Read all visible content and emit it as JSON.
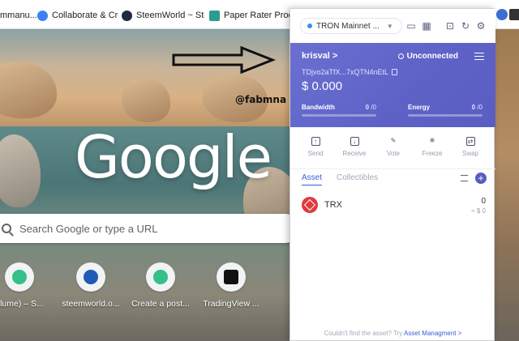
{
  "bookmarks": [
    {
      "label": "mmanu...",
      "color": "#6d6d6d"
    },
    {
      "label": "Collaborate & Crea...",
      "color": "#3b82f6"
    },
    {
      "label": "SteemWorld ~ Stee...",
      "color": "#1f2a44"
    },
    {
      "label": "Paper Rater Proofre...",
      "color": "#2a9d8f"
    }
  ],
  "newtab": {
    "logo": "Google",
    "search_placeholder": "Search Google or type a URL",
    "watermark": "@fabmna",
    "shortcuts": [
      {
        "label": "alume) – S...",
        "color": "#34c08a"
      },
      {
        "label": "steemworld.o...",
        "color": "#1f5ab8"
      },
      {
        "label": "Create a post...",
        "color": "#34c08a"
      },
      {
        "label": "TradingView ...",
        "color": "#111111"
      }
    ]
  },
  "wallet": {
    "network": "TRON Mainnet ...",
    "account_name": "krisval >",
    "status": "Unconnected",
    "address": "TDjvo2aTfX...7xQTN4nEtL",
    "balance": "$ 0.000",
    "bandwidth": {
      "label": "Bandwidth",
      "value": "0",
      "max": "/0"
    },
    "energy": {
      "label": "Energy",
      "value": "0",
      "max": "/0"
    },
    "actions": [
      {
        "label": "Send",
        "icon": "send-icon",
        "glyph": "↑"
      },
      {
        "label": "Receive",
        "icon": "receive-icon",
        "glyph": "↓"
      },
      {
        "label": "Vote",
        "icon": "vote-icon",
        "glyph": "✎"
      },
      {
        "label": "Freeze",
        "icon": "freeze-icon",
        "glyph": "❄"
      },
      {
        "label": "Swap",
        "icon": "swap-icon",
        "glyph": "⇄"
      }
    ],
    "tabs": {
      "asset": "Asset",
      "collectibles": "Collectibles"
    },
    "token": {
      "name": "TRX",
      "amount": "0",
      "usd": "≈ $ 0"
    },
    "footer_text": "Couldn't find the asset? Try",
    "footer_link": "Asset Managment >",
    "accent": "#5e62c7"
  }
}
